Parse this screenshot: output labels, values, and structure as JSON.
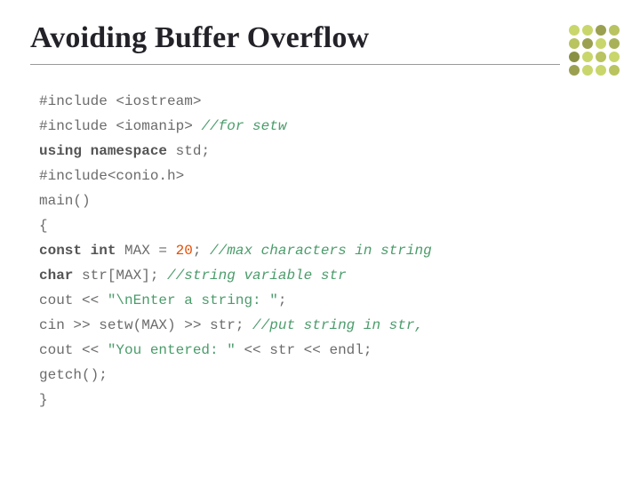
{
  "title": "Avoiding Buffer Overflow",
  "code": {
    "l1": {
      "pre": "#include ",
      "head": "<iostream>"
    },
    "l2": {
      "pre": "#include ",
      "head": "<iomanip>",
      "cmt": " //for setw"
    },
    "l3": {
      "kw1": "using",
      "kw2": " namespace",
      "rest": " std;"
    },
    "l4": {
      "pre": "#include",
      "head": "<conio.h>"
    },
    "l5": "main()",
    "l6": "{",
    "l7": {
      "kw1": "const",
      "kw2": " int",
      "rest": " MAX = ",
      "num": "20",
      "after": "; ",
      "cmt": "//max characters in string"
    },
    "l8": {
      "kw": "char",
      "rest": " str[MAX]; ",
      "cmt": "//string variable str"
    },
    "l9": {
      "pre": "cout << ",
      "str": "\"\\nEnter a string: \"",
      "after": ";"
    },
    "l10": {
      "pre": "cin >> setw(MAX) >> str; ",
      "cmt": "//put string in str,"
    },
    "l11": {
      "pre": "cout << ",
      "str": "\"You entered: \"",
      "after": " << str << endl;"
    },
    "l12": "getch();",
    "l13": "}"
  },
  "dot_colors": [
    "#c9d66b",
    "#c9d66b",
    "#9aa04f",
    "#b9c35f",
    "#b9c35f",
    "#9aa04f",
    "#c9d66b",
    "#a8b157",
    "#8a9043",
    "#c9d66b",
    "#b9c35f",
    "#c9d66b",
    "#9aa04f",
    "#c9d66b",
    "#c9d66b",
    "#b9c35f"
  ]
}
